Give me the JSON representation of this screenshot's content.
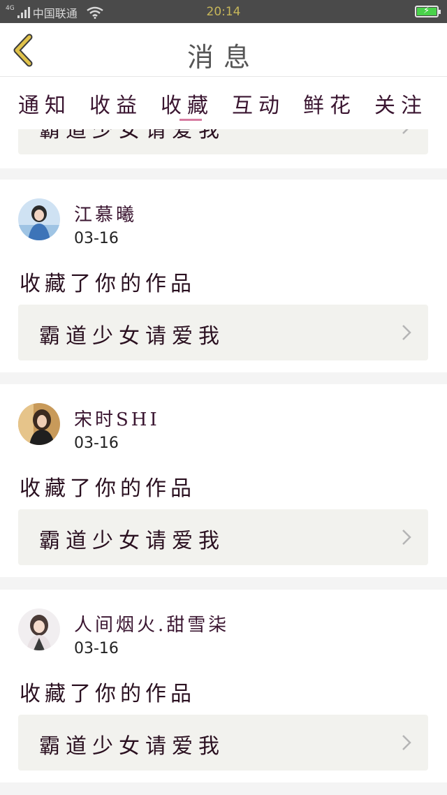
{
  "status_bar": {
    "network": "4G",
    "carrier": "中国联通",
    "time": "20:14"
  },
  "header": {
    "title": "消息"
  },
  "tabs": [
    {
      "label": "通知"
    },
    {
      "label": "收益"
    },
    {
      "label": "收藏",
      "active": true
    },
    {
      "label": "互动"
    },
    {
      "label": "鲜花"
    },
    {
      "label": "关注"
    }
  ],
  "partial_card": {
    "work_title": "霸道少女请爱我"
  },
  "notifications": [
    {
      "username": "江慕曦",
      "date": "03-16",
      "action": "收藏了你的作品",
      "work_title": "霸道少女请爱我"
    },
    {
      "username": "宋时SHI",
      "date": "03-16",
      "action": "收藏了你的作品",
      "work_title": "霸道少女请爱我"
    },
    {
      "username": "人间烟火.甜雪柒",
      "date": "03-16",
      "action": "收藏了你的作品",
      "work_title": "霸道少女请爱我"
    }
  ],
  "icons": {
    "back": "chevron-left-icon",
    "row_arrow": "chevron-right-icon",
    "wifi": "wifi-icon",
    "battery": "battery-charging-icon"
  },
  "colors": {
    "accent_underline": "#d67ba0",
    "back_arrow": "#e0c24a",
    "page_bg": "#f4f4f4",
    "work_bg": "#f2f2ee"
  }
}
